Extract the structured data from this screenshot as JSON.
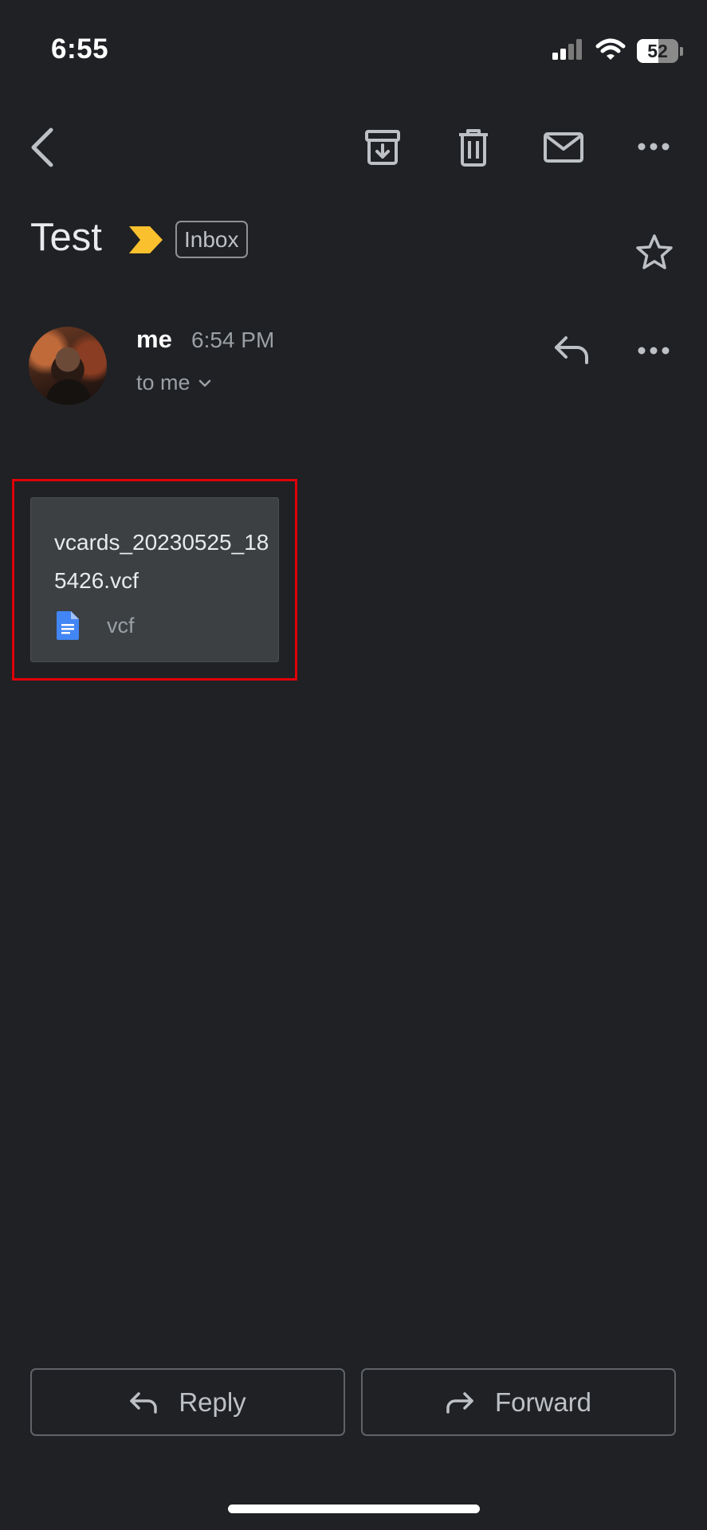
{
  "status_bar": {
    "time": "6:55",
    "battery": "52",
    "battery_level_percent": 52,
    "icons": [
      "cellular-signal-icon",
      "wifi-icon",
      "battery-icon"
    ]
  },
  "toolbar": {
    "icons": [
      "back-icon",
      "archive-icon",
      "delete-icon",
      "mark-unread-icon",
      "more-icon"
    ]
  },
  "message": {
    "subject": "Test",
    "label": "Inbox",
    "sender": "me",
    "time": "6:54 PM",
    "recipient": "to me"
  },
  "attachment": {
    "name": "vcards_20230525_185426.vcf",
    "type": "vcf",
    "icon": "document-icon"
  },
  "actions": {
    "reply_label": "Reply",
    "forward_label": "Forward"
  },
  "colors": {
    "background": "#202124",
    "card": "#3c4043",
    "importance": "#fbc02d",
    "highlight": "#e00008",
    "doc_icon": "#4285f4"
  }
}
